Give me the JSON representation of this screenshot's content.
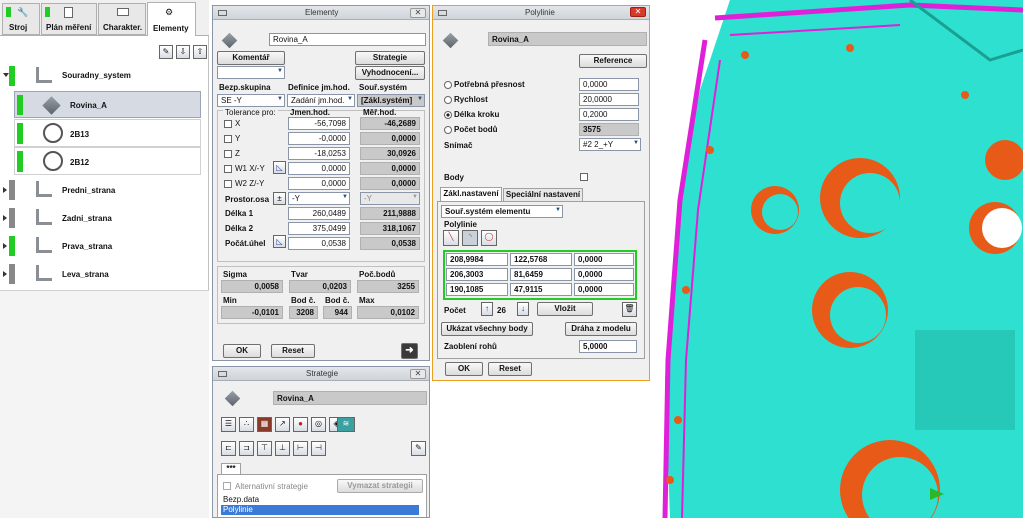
{
  "left": {
    "tabs": [
      {
        "label": "Stroj"
      },
      {
        "label": "Plán měření"
      },
      {
        "label": "Charakter."
      },
      {
        "label": "Elementy"
      }
    ],
    "tree": [
      {
        "label": "Souradny_system",
        "marker": "#22cc22"
      },
      {
        "label": "Rovina_A",
        "marker": "#22cc22"
      },
      {
        "label": "2B13",
        "marker": "#22cc22"
      },
      {
        "label": "2B12",
        "marker": "#22cc22"
      },
      {
        "label": "Predni_strana",
        "marker": "#888888"
      },
      {
        "label": "Zadni_strana",
        "marker": "#888888"
      },
      {
        "label": "Prava_strana",
        "marker": "#22cc22"
      },
      {
        "label": "Leva_strana",
        "marker": "#888888"
      }
    ]
  },
  "elementy": {
    "title": "Elementy",
    "name": "Rovina_A",
    "komentar": "Komentář",
    "strategie": "Strategie",
    "vyhodnoceni": "Vyhodnocení...",
    "col_bezp": "Bezp.skupina",
    "col_def": "Definice jm.hod.",
    "col_sour": "Souř.systém",
    "bezp_val": "SE -Y",
    "def_val": "Zadání jm.hod.",
    "sour_val": "[Zákl.systém]",
    "tol_hdr": "Tolerance pro:",
    "jmen_hdr": "Jmen.hod.",
    "mer_hdr": "Měř.hod.",
    "rows": [
      {
        "label": "X",
        "jmen": "-56,7098",
        "mer": "-46,2689"
      },
      {
        "label": "Y",
        "jmen": "-0,0000",
        "mer": "0,0000"
      },
      {
        "label": "Z",
        "jmen": "-18,0253",
        "mer": "30,0926"
      },
      {
        "label": "W1 X/-Y",
        "jmen": "0,0000",
        "mer": "0,0000"
      },
      {
        "label": "W2 Z/-Y",
        "jmen": "0,0000",
        "mer": "0,0000"
      }
    ],
    "prostor_lbl": "Prostor.osa",
    "prostor_val": "-Y",
    "prostor_mer": "-Y",
    "delka1_lbl": "Délka 1",
    "delka1_jmen": "260,0489",
    "delka1_mer": "211,9888",
    "delka2_lbl": "Délka 2",
    "delka2_jmen": "375,0499",
    "delka2_mer": "318,1067",
    "uhel_lbl": "Počát.úhel",
    "uhel_jmen": "0,0538",
    "uhel_mer": "0,0538",
    "sigma_lbl": "Sigma",
    "sigma": "0,0058",
    "tvar_lbl": "Tvar",
    "tvar": "0,0203",
    "pocbodu_lbl": "Poč.bodů",
    "pocbodu": "3255",
    "min_lbl": "Min",
    "min": "-0,0101",
    "bodc1_lbl": "Bod č.",
    "bodc1": "3208",
    "bodc2_lbl": "Bod č.",
    "bodc2": "944",
    "max_lbl": "Max",
    "max": "0,0102",
    "ok": "OK",
    "reset": "Reset"
  },
  "strategie": {
    "title": "Strategie",
    "name": "Rovina_A",
    "tab": "***",
    "alt": "Alternativní strategie",
    "vymazat": "Vymazat strategii",
    "list": [
      {
        "label": "Bezp.data"
      },
      {
        "label": "Polylinie"
      }
    ]
  },
  "polylinie": {
    "title": "Polylinie",
    "name": "Rovina_A",
    "reference": "Reference",
    "fields": [
      {
        "label": "Potřebná přesnost",
        "value": "0,0000"
      },
      {
        "label": "Rychlost",
        "value": "20,0000"
      },
      {
        "label": "Délka kroku",
        "value": "0,2000"
      },
      {
        "label": "Počet bodů",
        "value": "3575"
      }
    ],
    "snimac_lbl": "Snímač",
    "snimac_val": "#2   2_+Y",
    "body_lbl": "Body",
    "tabs": [
      {
        "label": "Zákl.nastavení"
      },
      {
        "label": "Speciální nastavení"
      }
    ],
    "coord_sel": "Souř.systém elementu",
    "group": "Polylinie",
    "points": [
      [
        "208,9984",
        "122,5768",
        "0,0000"
      ],
      [
        "206,3003",
        "81,6459",
        "0,0000"
      ],
      [
        "190,1085",
        "47,9115",
        "0,0000"
      ]
    ],
    "pocet_lbl": "Počet",
    "pocet": "26",
    "vlozit": "Vložit",
    "ukazat": "Ukázat všechny body",
    "draha": "Dráha z modelu",
    "zaobleni_lbl": "Zaoblení rohů",
    "zaobleni": "5,0000",
    "ok": "OK",
    "reset": "Reset"
  },
  "colors": {
    "cyan": "#2ee0cf",
    "magenta": "#e020d8",
    "orange": "#e85a18",
    "highlight": "#22cc22"
  }
}
